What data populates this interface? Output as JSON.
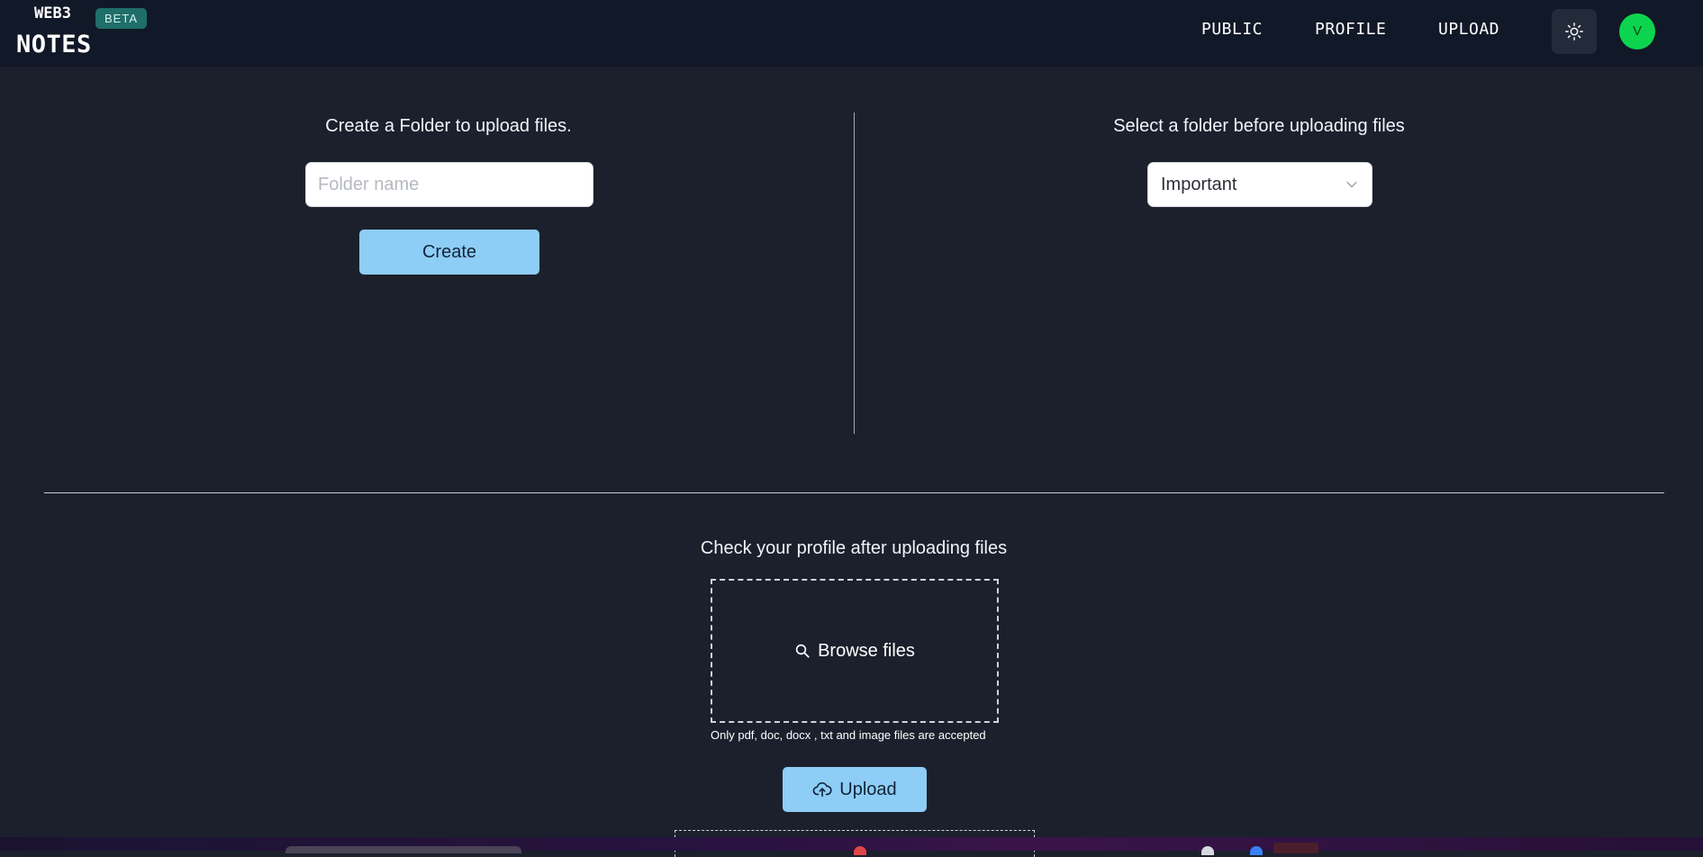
{
  "header": {
    "brand_small": "WEB3",
    "brand_big": "NOTES",
    "badge": "BETA",
    "nav": [
      "PUBLIC",
      "PROFILE",
      "UPLOAD"
    ],
    "theme_icon": "sun-icon",
    "avatar_initial": "V",
    "avatar_color": "#0dd44e"
  },
  "create_folder": {
    "heading": "Create a Folder to upload files.",
    "input_placeholder": "Folder name",
    "input_value": "",
    "button_label": "Create"
  },
  "select_folder": {
    "heading": "Select a folder before uploading files",
    "selected": "Important"
  },
  "upload": {
    "heading": "Check your profile after uploading files",
    "browse_label": "Browse files",
    "hint": "Only pdf, doc, docx , txt and image files are accepted",
    "button_label": "Upload"
  },
  "colors": {
    "background": "#1b202c",
    "header_bg": "#111827",
    "accent": "#8ecdf5",
    "badge_bg": "#1f6e6a"
  }
}
